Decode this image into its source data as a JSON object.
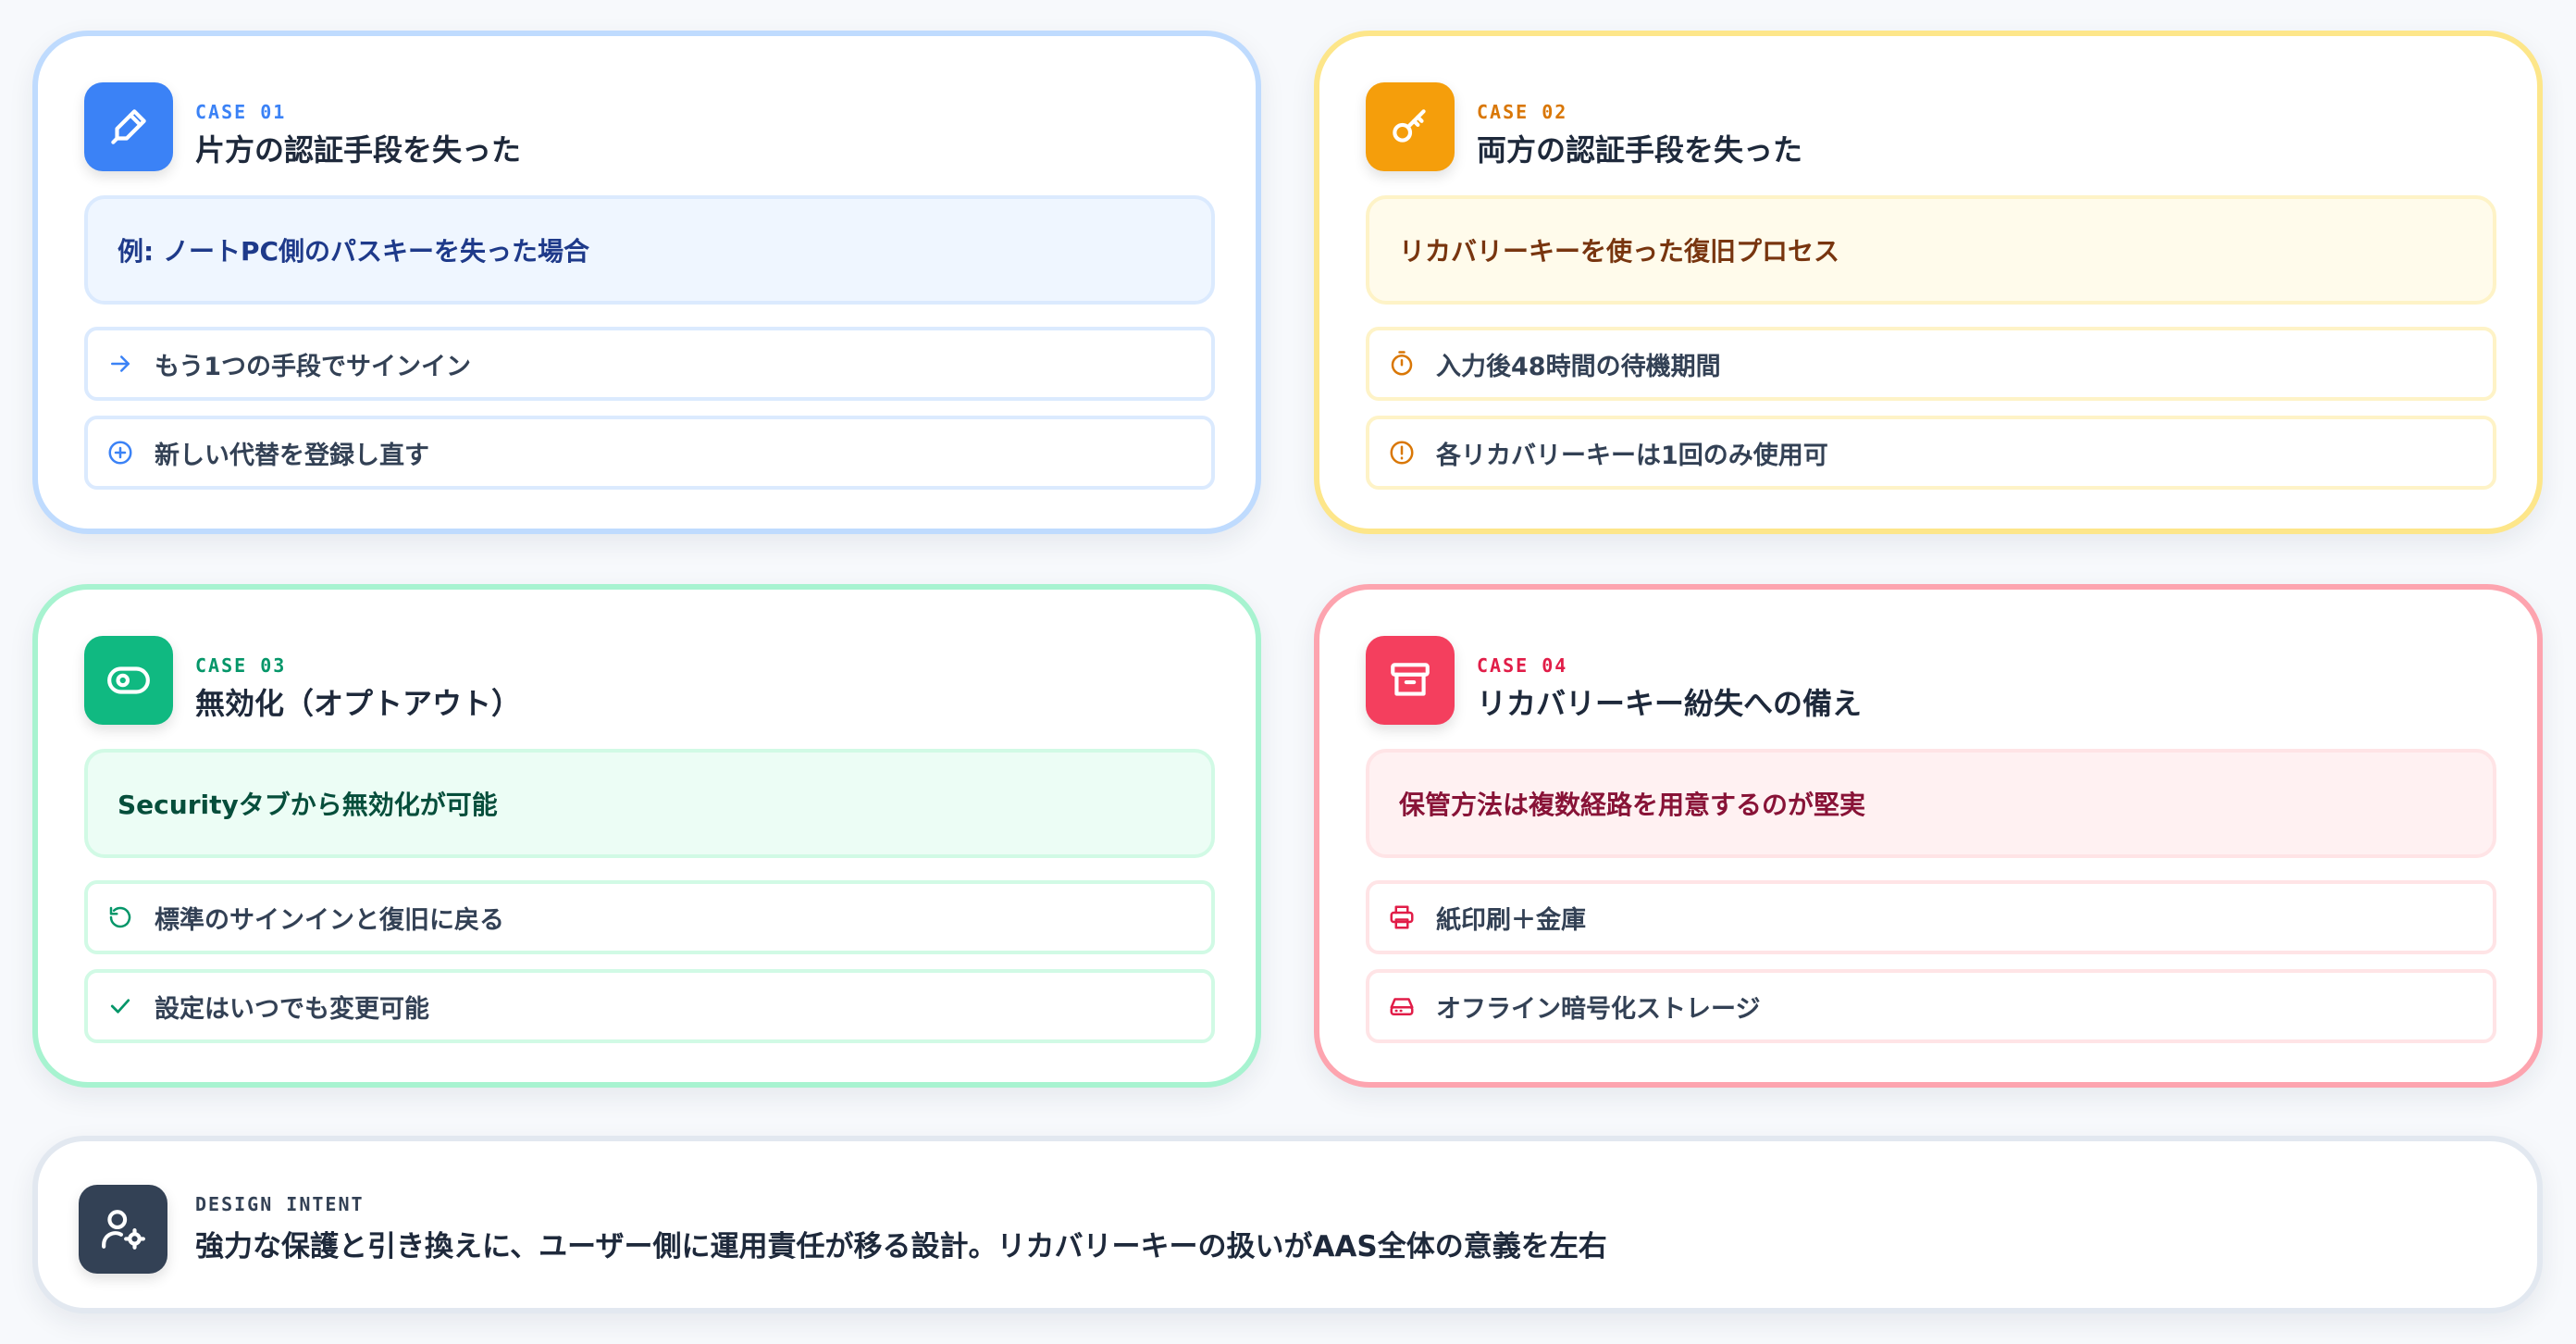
{
  "cases": [
    {
      "label": "CASE 01",
      "title": "片方の認証手段を失った",
      "icon": "fingerprint-pen-icon",
      "highlight": "例: ノートPC側のパスキーを失った場合",
      "rows": [
        {
          "icon": "arrow-right-icon",
          "text": "もう1つの手段でサインイン"
        },
        {
          "icon": "plus-circle-icon",
          "text": "新しい代替を登録し直す"
        }
      ]
    },
    {
      "label": "CASE 02",
      "title": "両方の認証手段を失った",
      "icon": "key-icon",
      "highlight": "リカバリーキーを使った復旧プロセス",
      "rows": [
        {
          "icon": "timer-icon",
          "text": "入力後48時間の待機期間"
        },
        {
          "icon": "alert-circle-icon",
          "text": "各リカバリーキーは1回のみ使用可"
        }
      ]
    },
    {
      "label": "CASE 03",
      "title": "無効化（オプトアウト）",
      "icon": "toggle-icon",
      "highlight": "Securityタブから無効化が可能",
      "rows": [
        {
          "icon": "rotate-ccw-icon",
          "text": "標準のサインインと復旧に戻る"
        },
        {
          "icon": "check-icon",
          "text": "設定はいつでも変更可能"
        }
      ]
    },
    {
      "label": "CASE 04",
      "title": "リカバリーキー紛失への備え",
      "icon": "archive-icon",
      "highlight": "保管方法は複数経路を用意するのが堅実",
      "rows": [
        {
          "icon": "printer-icon",
          "text": "紙印刷＋金庫"
        },
        {
          "icon": "hard-drive-icon",
          "text": "オフライン暗号化ストレージ"
        }
      ]
    }
  ],
  "intent": {
    "label": "DESIGN INTENT",
    "icon": "user-gear-icon",
    "text": "強力な保護と引き換えに、ユーザー側に運用責任が移る設計。リカバリーキーの扱いがAAS全体の意義を左右"
  }
}
